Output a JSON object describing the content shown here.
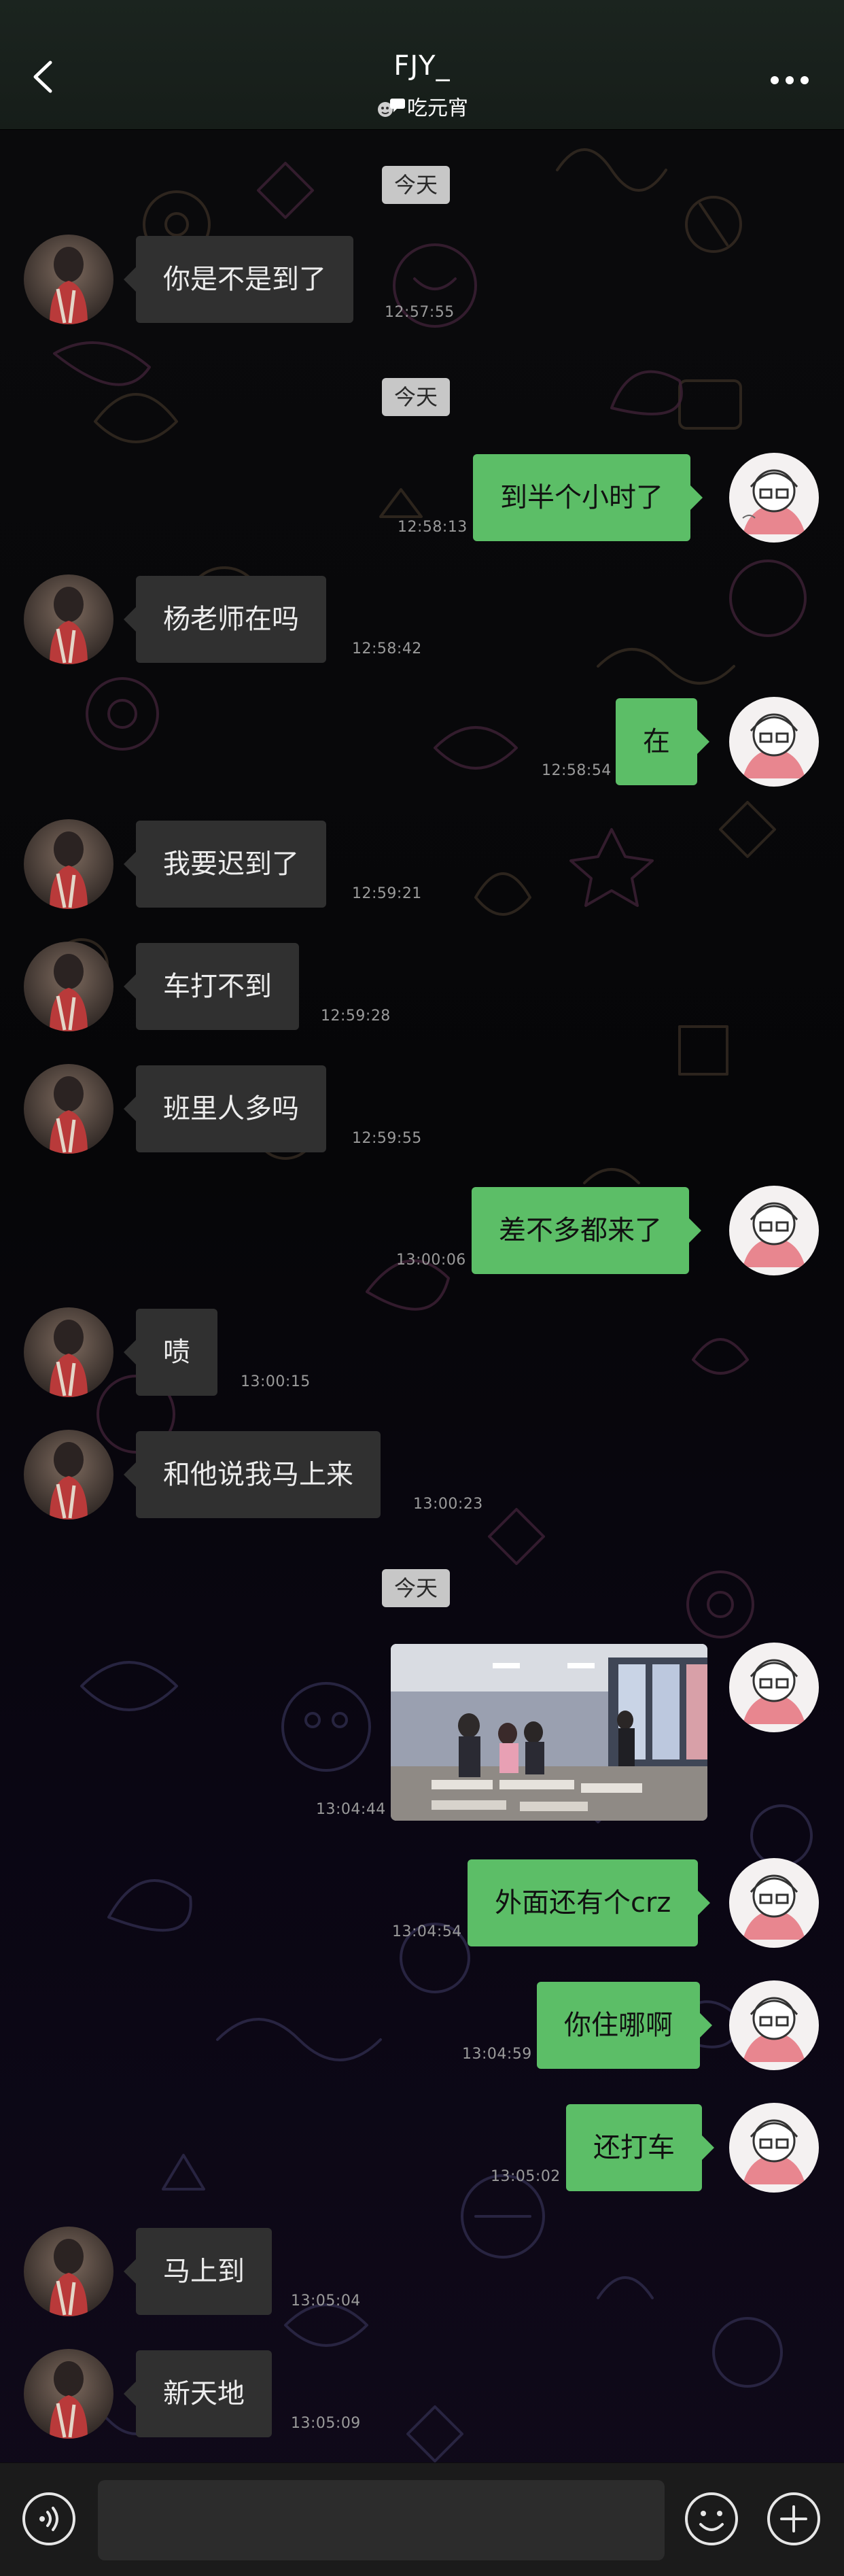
{
  "header": {
    "title": "FJY_",
    "subtitle": "吃元宵",
    "back_icon": "chevron-left-icon",
    "more_icon": "more-dots-icon",
    "status_icon": "chat-bubble-status-icon"
  },
  "messages": [
    {
      "kind": "date",
      "label": "今天"
    },
    {
      "kind": "text",
      "side": "left",
      "text": "你是不是到了",
      "time": "12:57:55"
    },
    {
      "kind": "date",
      "label": "今天"
    },
    {
      "kind": "text",
      "side": "right",
      "text": "到半个小时了",
      "time": "12:58:13"
    },
    {
      "kind": "text",
      "side": "left",
      "text": "杨老师在吗",
      "time": "12:58:42"
    },
    {
      "kind": "text",
      "side": "right",
      "text": "在",
      "time": "12:58:54"
    },
    {
      "kind": "text",
      "side": "left",
      "text": "我要迟到了",
      "time": "12:59:21"
    },
    {
      "kind": "text",
      "side": "left",
      "text": "车打不到",
      "time": "12:59:28"
    },
    {
      "kind": "text",
      "side": "left",
      "text": "班里人多吗",
      "time": "12:59:55"
    },
    {
      "kind": "text",
      "side": "right",
      "text": "差不多都来了",
      "time": "13:00:06"
    },
    {
      "kind": "text",
      "side": "left",
      "text": "啧",
      "time": "13:00:15"
    },
    {
      "kind": "text",
      "side": "left",
      "text": "和他说我马上来",
      "time": "13:00:23"
    },
    {
      "kind": "date",
      "label": "今天"
    },
    {
      "kind": "image",
      "side": "right",
      "time": "13:04:44"
    },
    {
      "kind": "text",
      "side": "right",
      "text": "外面还有个crz",
      "time": "13:04:54"
    },
    {
      "kind": "text",
      "side": "right",
      "text": "你住哪啊",
      "time": "13:04:59"
    },
    {
      "kind": "text",
      "side": "right",
      "text": "还打车",
      "time": "13:05:02"
    },
    {
      "kind": "text",
      "side": "left",
      "text": "马上到",
      "time": "13:05:04"
    },
    {
      "kind": "text",
      "side": "left",
      "text": "新天地",
      "time": "13:05:09"
    }
  ],
  "composer": {
    "value": "",
    "voice_icon": "voice-icon",
    "emoji_icon": "emoji-icon",
    "plus_icon": "plus-icon"
  },
  "colors": {
    "header_bg": "#1b241f",
    "bubble_right": "#5cbe67",
    "bubble_left": "#303030",
    "date_chip": "#c7c7c7",
    "timestamp": "#9a9a9a"
  }
}
